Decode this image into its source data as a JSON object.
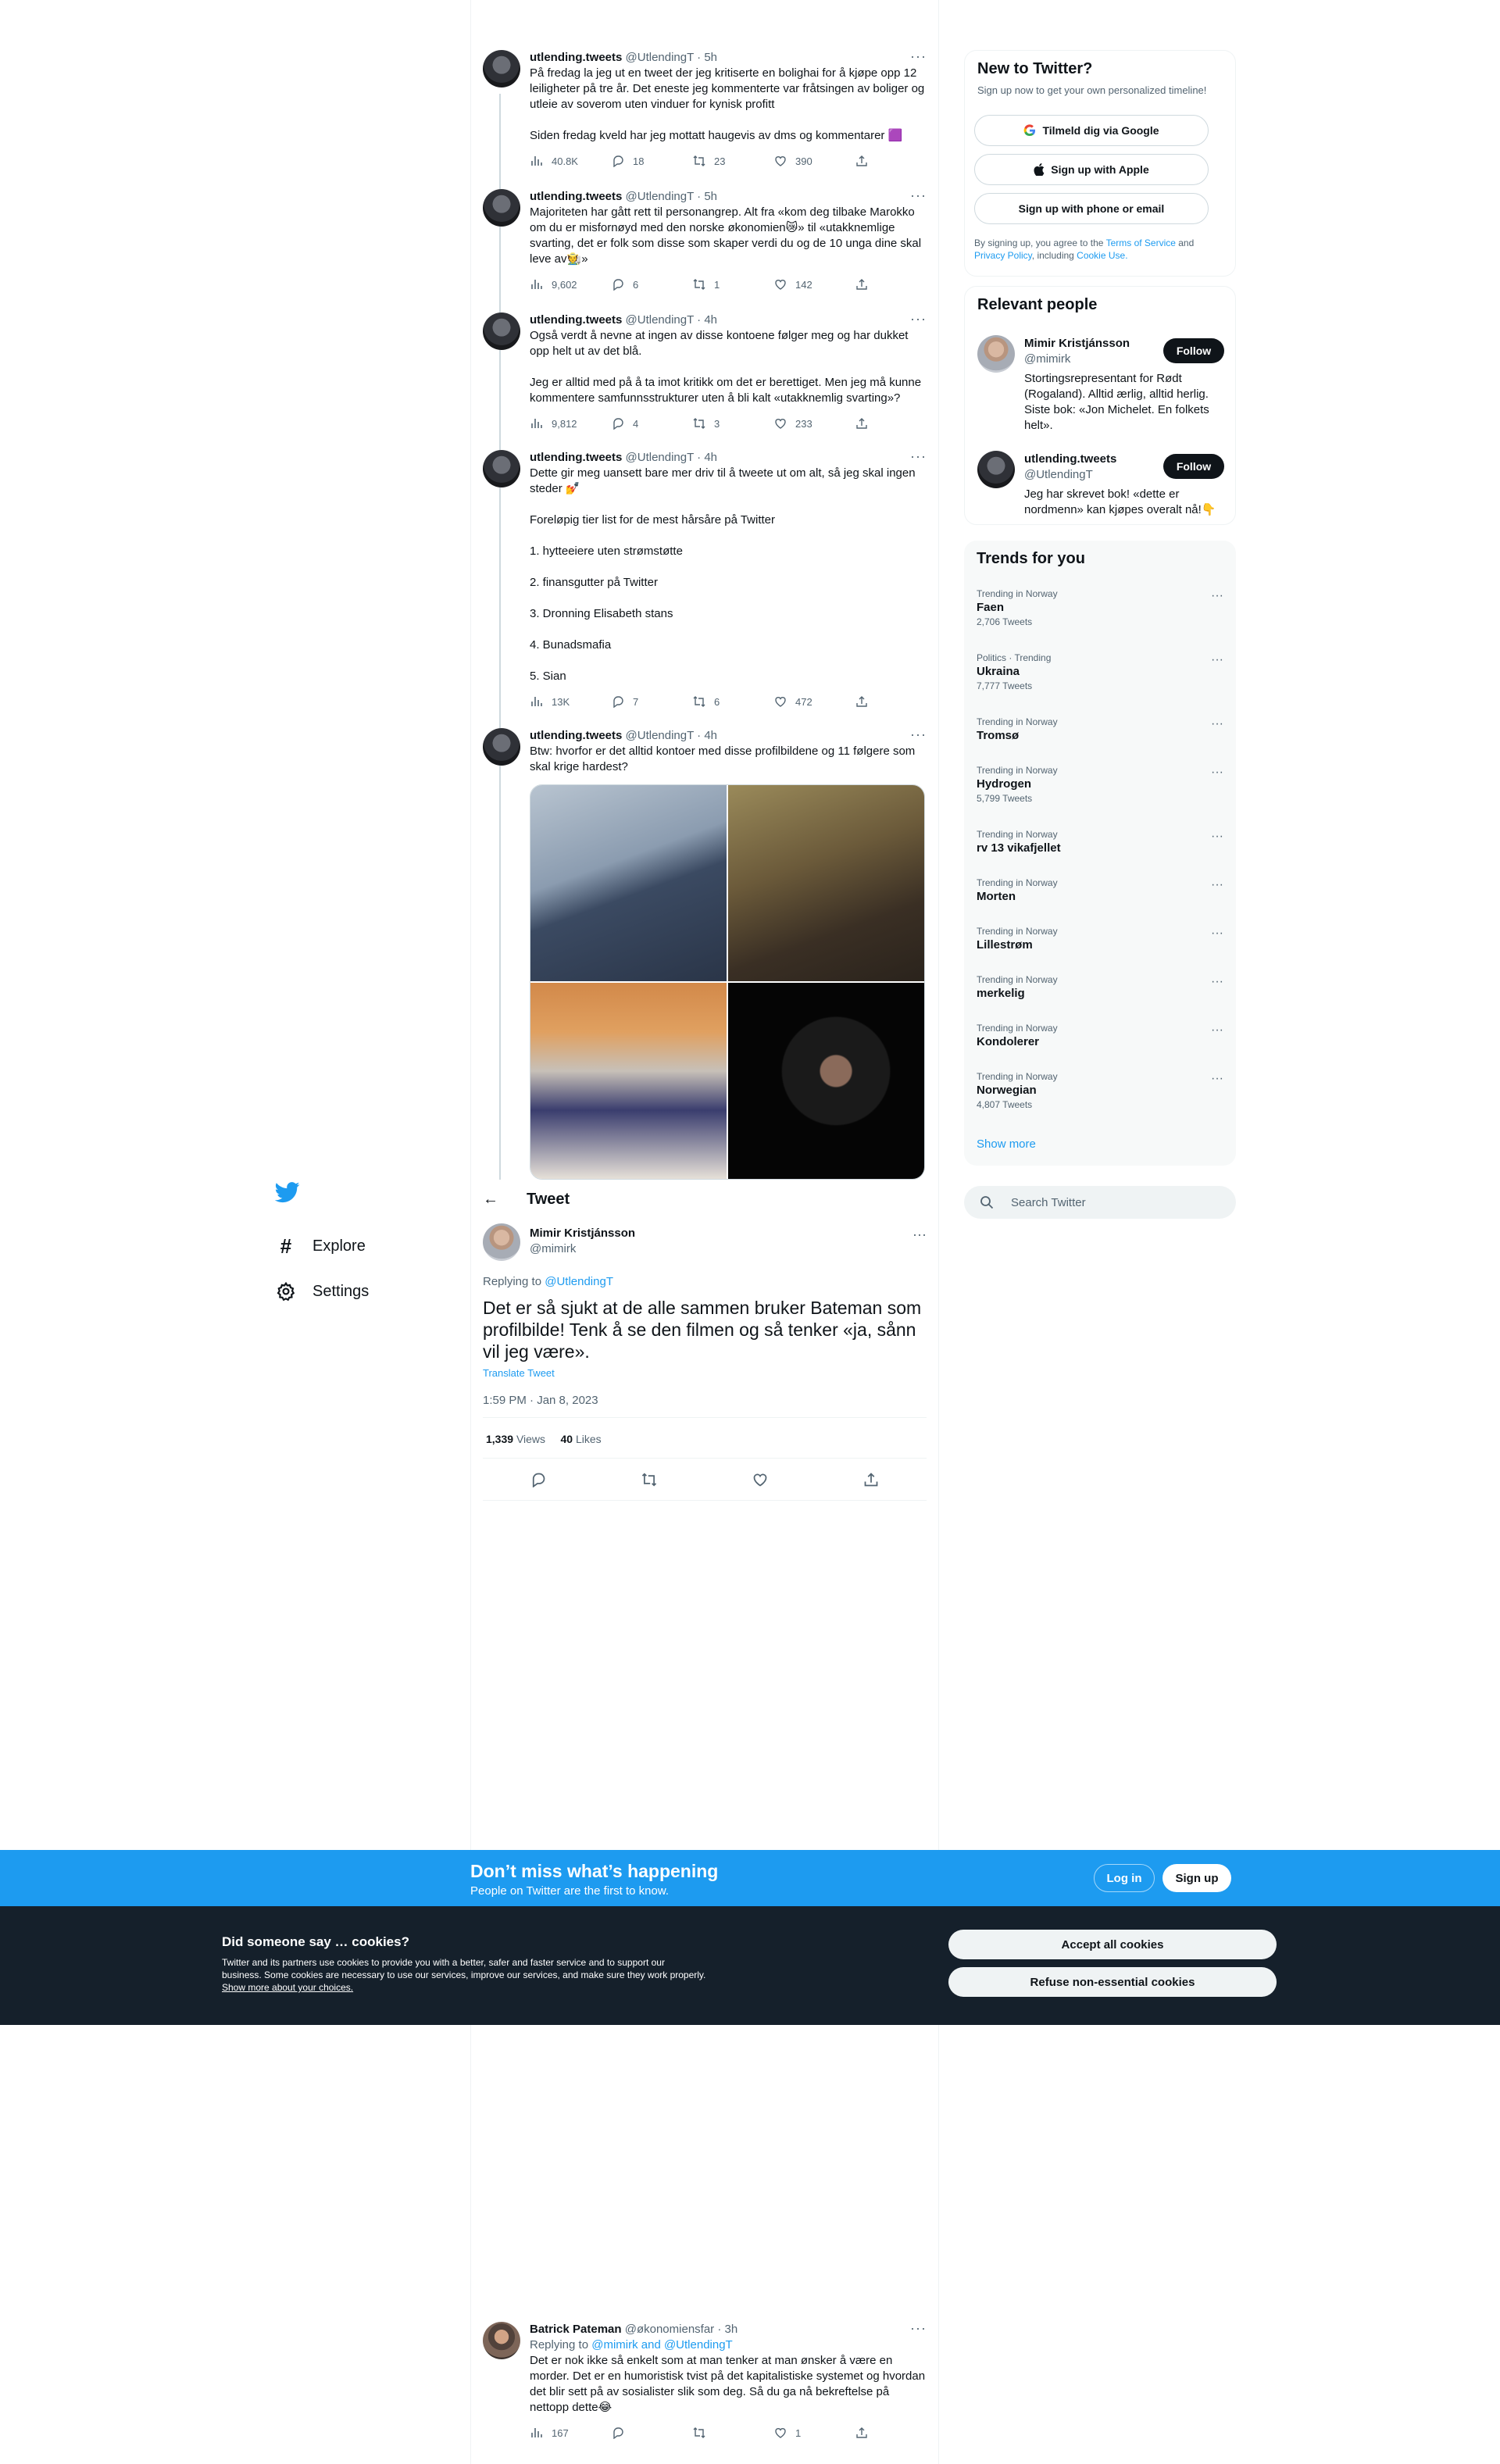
{
  "colors": {
    "accent": "#1d9bf0",
    "text": "#0f1419",
    "secondary": "#536471",
    "banner": "#1d9bf0",
    "cookie_bg": "#15202b"
  },
  "nav": {
    "logo": "twitter-bird-icon",
    "items": [
      {
        "label": "Explore",
        "icon": "hashtag-icon"
      },
      {
        "label": "Settings",
        "icon": "gear-icon"
      }
    ]
  },
  "thread": [
    {
      "name": "utlending.tweets",
      "handle": "@UtlendingT · 5h",
      "text": "På fredag la jeg ut en tweet der jeg kritiserte en bolighai for å kjøpe opp 12 leiligheter på tre år. Det eneste jeg kommenterte var fråtsingen av boliger og utleie av soverom uten vinduer for kynisk profitt\n\nSiden fredag kveld har jeg mottatt haugevis av dms og kommentarer 🟪",
      "views": "40.8K",
      "replies": "18",
      "retweets": "23",
      "likes": "390"
    },
    {
      "name": "utlending.tweets",
      "handle": "@UtlendingT · 5h",
      "text": "Majoriteten har gått rett til personangrep. Alt fra «kom deg tilbake Marokko om du er misfornøyd med den norske økonomien😿» til «utakknemlige svarting, det er folk som disse som skaper verdi du og de 10 unga dine skal leve av🧑‍🌾»",
      "views": "9,602",
      "replies": "6",
      "retweets": "1",
      "likes": "142"
    },
    {
      "name": "utlending.tweets",
      "handle": "@UtlendingT · 4h",
      "text": "Også verdt å nevne at ingen av disse kontoene følger meg og har dukket opp helt ut av det blå.\n\nJeg er alltid med på å ta imot kritikk om det er berettiget. Men jeg må kunne kommentere samfunnsstrukturer uten å bli kalt «utakknemlig svarting»?",
      "views": "9,812",
      "replies": "4",
      "retweets": "3",
      "likes": "233"
    },
    {
      "name": "utlending.tweets",
      "handle": "@UtlendingT · 4h",
      "text": "Dette gir meg uansett bare mer driv til å tweete ut om alt, så jeg skal ingen steder 💅\n\nForeløpig tier list for de mest hårsåre på Twitter\n\n1. hytteeiere uten strømstøtte\n\n2. finansgutter på Twitter\n\n3. Dronning Elisabeth stans\n\n4. Bunadsmafia\n\n5. Sian",
      "views": "13K",
      "replies": "7",
      "retweets": "6",
      "likes": "472"
    },
    {
      "name": "utlending.tweets",
      "handle": "@UtlendingT · 4h",
      "text": "Btw: hvorfor er det alltid kontoer med disse profilbildene og 11 følgere som skal krige hardest?",
      "views": "",
      "replies": "",
      "retweets": "",
      "likes": ""
    }
  ],
  "focus": {
    "header_title": "Tweet",
    "name": "Mimir Kristjánsson",
    "handle": "@mimirk",
    "replying_prefix": "Replying to ",
    "replying_to": "@UtlendingT",
    "text": "Det er så sjukt at de alle sammen bruker Bateman som profilbilde! Tenk å se den filmen og så tenker «ja, sånn vil jeg være».",
    "translate": "Translate Tweet",
    "time": "1:59 PM · Jan 8, 2023",
    "views_count": "1,339",
    "views_label": "Views",
    "likes_count": "40",
    "likes_label": "Likes"
  },
  "reply": {
    "name": "Batrick Pateman",
    "handle": "@økonomiensfar · 3h",
    "replying_prefix": "Replying to ",
    "replying_to": "@mimirk and @UtlendingT",
    "text": "Det er nok ikke så enkelt som at man tenker at man ønsker å være en morder. Det er en humoristisk tvist på det kapitalistiske systemet og hvordan det blir sett på av sosialister slik som deg. Så du ga nå bekreftelse på nettopp dette😂",
    "views": "167",
    "likes": "1"
  },
  "sidebar": {
    "new_to_twitter": {
      "title": "New to Twitter?",
      "subtitle": "Sign up now to get your own personalized timeline!",
      "google": "Tilmeld dig via Google",
      "apple": "Sign up with Apple",
      "phone": "Sign up with phone or email",
      "legal_1": "By signing up, you agree to the ",
      "terms": "Terms of Service",
      "legal_2": " and ",
      "privacy": "Privacy Policy",
      "legal_3": ", including ",
      "cookie": "Cookie Use."
    },
    "relevant_people": {
      "title": "Relevant people",
      "people": [
        {
          "name": "Mimir Kristjánsson",
          "handle": "@mimirk",
          "bio": "Stortingsrepresentant for Rødt (Rogaland). Alltid ærlig, alltid herlig. Siste bok: «Jon Michelet. En folkets helt».",
          "follow": "Follow"
        },
        {
          "name": "utlending.tweets",
          "handle": "@UtlendingT",
          "bio": "Jeg har skrevet bok! «dette er nordmenn» kan kjøpes overalt nå!👇",
          "follow": "Follow"
        }
      ]
    },
    "trends": {
      "title": "Trends for you",
      "items": [
        {
          "meta": "Trending in Norway",
          "name": "Faen",
          "count": "2,706 Tweets"
        },
        {
          "meta": "Politics · Trending",
          "name": "Ukraina",
          "count": "7,777 Tweets"
        },
        {
          "meta": "Trending in Norway",
          "name": "Tromsø",
          "count": ""
        },
        {
          "meta": "Trending in Norway",
          "name": "Hydrogen",
          "count": "5,799 Tweets"
        },
        {
          "meta": "Trending in Norway",
          "name": "rv 13 vikafjellet",
          "count": ""
        },
        {
          "meta": "Trending in Norway",
          "name": "Morten",
          "count": ""
        },
        {
          "meta": "Trending in Norway",
          "name": "Lillestrøm",
          "count": ""
        },
        {
          "meta": "Trending in Norway",
          "name": "merkelig",
          "count": ""
        },
        {
          "meta": "Trending in Norway",
          "name": "Kondolerer",
          "count": ""
        },
        {
          "meta": "Trending in Norway",
          "name": "Norwegian",
          "count": "4,807 Tweets"
        }
      ],
      "show_more": "Show more"
    },
    "search_placeholder": "Search Twitter"
  },
  "banner": {
    "headline": "Don’t miss what’s happening",
    "sub": "People on Twitter are the first to know.",
    "login": "Log in",
    "signup": "Sign up"
  },
  "cookies": {
    "title": "Did someone say … cookies?",
    "body": "Twitter and its partners use cookies to provide you with a better, safer and faster service and to support our business. Some cookies are necessary to use our services, improve our services, and make sure they work properly. ",
    "link": "Show more about your choices.",
    "accept": "Accept all cookies",
    "refuse": "Refuse non-essential cookies"
  }
}
